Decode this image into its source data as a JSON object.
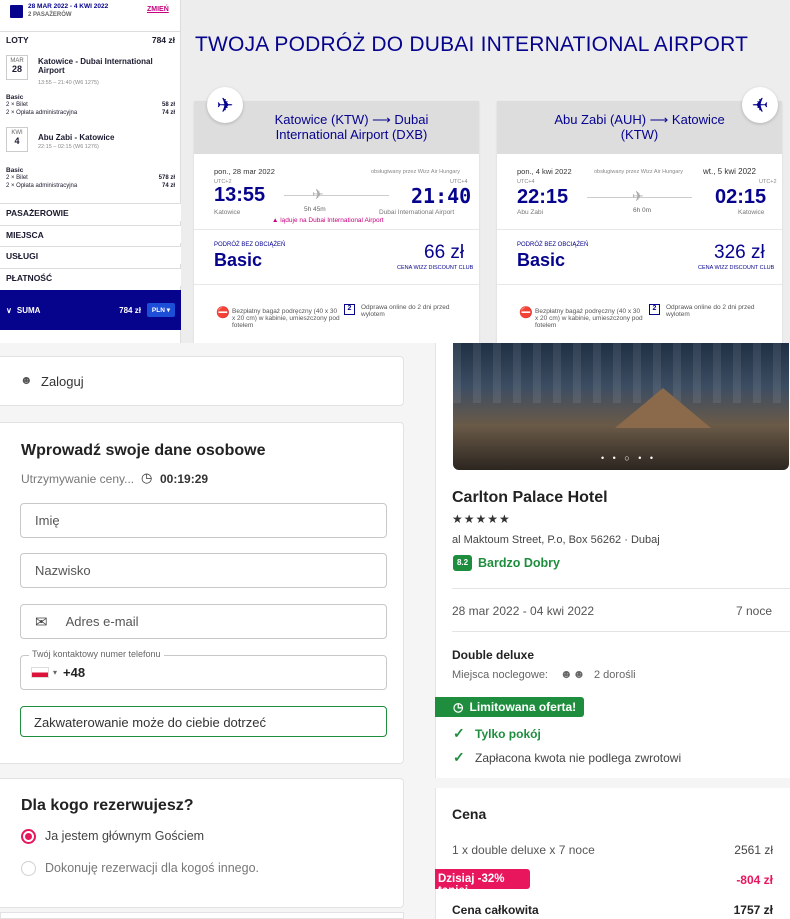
{
  "sidebar": {
    "dates": "28 MAR 2022 - 4 KWI 2022",
    "passengers": "2 PASAŻERÓW",
    "change": "ZMIEŃ",
    "flights_label": "LOTY",
    "flights_total": "784 zł",
    "out": {
      "month": "MAR",
      "day": "28",
      "route": "Katowice - Dubai International Airport",
      "detail": "13:55 – 21:40 (W6 1275)",
      "fare": "Basic",
      "ticket": "2 × Bilet",
      "ticket_price": "58 zł",
      "fee": "2 × Opłata administracyjna",
      "fee_price": "74 zł"
    },
    "ret": {
      "month": "KWI",
      "day": "4",
      "route": "Abu Zabi - Katowice",
      "detail": "22:15 – 02:15 (W6 1276)",
      "fare": "Basic",
      "ticket": "2 × Bilet",
      "ticket_price": "578 zł",
      "fee": "2 × Opłata administracyjna",
      "fee_price": "74 zł"
    },
    "sections": [
      "PASAŻEROWIE",
      "MIEJSCA",
      "USŁUGI",
      "PŁATNOŚĆ"
    ],
    "sum_label": "SUMA",
    "sum_value": "784 zł",
    "currency": "PLN"
  },
  "trip_title": "TWOJA PODRÓŻ DO DUBAI INTERNATIONAL AIRPORT",
  "flight_out": {
    "route": "Katowice (KTW) ⟶ Dubai International Airport (DXB)",
    "date": "pon., 28 mar 2022",
    "operated": "obsługiwany przez Wizz Air Hungary",
    "utc_dep": "UTC+2",
    "utc_arr": "UTC+4",
    "dep": "13:55",
    "arr": "21:40",
    "duration": "5h 45m",
    "from": "Katowice",
    "to": "Dubai International Airport",
    "landing": "▲ ląduje na Dubai International Airport",
    "fare_label": "PODRÓŻ BEZ OBCIĄŻEŃ",
    "fare": "Basic",
    "price": "66 zł",
    "club": "CENA WIZZ DISCOUNT CLUB",
    "bag": "Bezpłatny bagaż podręczny (40 x 30 x 20 cm) w kabinie, umieszczony pod fotelem",
    "checkin": "Odprawa online do 2 dni przed wylotem"
  },
  "flight_ret": {
    "route": "Abu Zabi (AUH) ⟶ Katowice (KTW)",
    "date": "pon., 4 kwi 2022",
    "date_arr": "wt., 5 kwi 2022",
    "operated": "obsługiwany przez Wizz Air Hungary",
    "utc_dep": "UTC+4",
    "utc_arr": "UTC+2",
    "dep": "22:15",
    "arr": "02:15",
    "duration": "6h 0m",
    "from": "Abu Zabi",
    "to": "Katowice",
    "fare_label": "PODRÓŻ BEZ OBCIĄŻEŃ",
    "fare": "Basic",
    "price": "326 zł",
    "club": "CENA WIZZ DISCOUNT CLUB",
    "bag": "Bezpłatny bagaż podręczny (40 x 30 x 20 cm) w kabinie, umieszczony pod fotelem",
    "checkin": "Odprawa online do 2 dni przed wylotem"
  },
  "login": "Zaloguj",
  "form": {
    "title": "Wprowadź swoje dane osobowe",
    "hold": "Utrzymywanie ceny...",
    "timer": "00:19:29",
    "first": "Imię",
    "last": "Nazwisko",
    "email": "Adres e-mail",
    "phone_label": "Twój kontaktowy numer telefonu",
    "phone_code": "+48",
    "info": "Zakwaterowanie może do ciebie dotrzeć"
  },
  "who": {
    "title": "Dla kogo rezerwujesz?",
    "opt1": "Ja jestem głównym Gościem",
    "opt2": "Dokonuję rezerwacji dla kogoś innego."
  },
  "hotel": {
    "name": "Carlton Palace Hotel",
    "stars": "★★★★★",
    "address": "al Maktoum Street, P.o, Box 56262 · Dubaj",
    "score": "8.2",
    "score_label": "Bardzo Dobry",
    "dates": "28 mar 2022 - 04 kwi 2022",
    "nights": "7 noce",
    "room": "Double deluxe",
    "sleeps_label": "Miejsca noclegowe:",
    "sleeps": "2 dorośli",
    "limited": "Limitowana oferta!",
    "room_only": "Tylko pokój",
    "nonref": "Zapłacona kwota nie podlega zwrotowi"
  },
  "price": {
    "title": "Cena",
    "line": "1 x double deluxe x 7 noce",
    "line_value": "2561 zł",
    "discount": "Dzisiaj -32% taniej",
    "discount_value": "-804 zł",
    "total_label": "Cena całkowita",
    "total": "1757 zł"
  },
  "colors": {
    "wizz_blue": "#06038d",
    "magenta": "#c6007e",
    "green": "#1e8e3e",
    "pink": "#e8175d"
  }
}
